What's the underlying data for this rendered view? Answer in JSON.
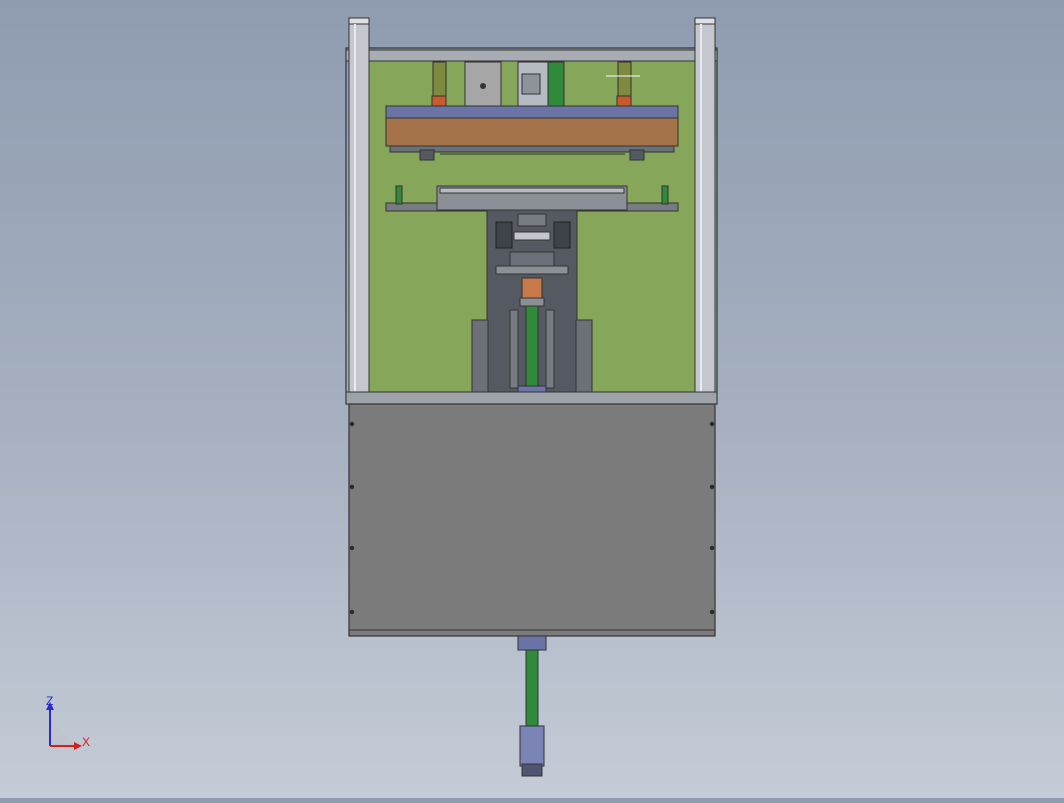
{
  "viewport": {
    "background_top": "#8f9cb0",
    "background_bottom": "#c5ccd7"
  },
  "model": {
    "colors": {
      "frame_green": "#86a65a",
      "frame_steel": "#b4b8bf",
      "panel_gray": "#7b7b7b",
      "dark_steel": "#555a62",
      "wood_brown": "#a4734a",
      "blue_plate": "#6b74a6",
      "cylinder_green": "#2f8a3a",
      "copper": "#c87a4a",
      "outline": "#1e1e1e"
    },
    "icons": [
      "pneumatic-cylinder-icon",
      "guide-post-icon",
      "press-plate-icon"
    ]
  },
  "triad": {
    "z_label": "Z",
    "x_label": "X",
    "z_color": "#2a2ad0",
    "x_color": "#d02020"
  }
}
